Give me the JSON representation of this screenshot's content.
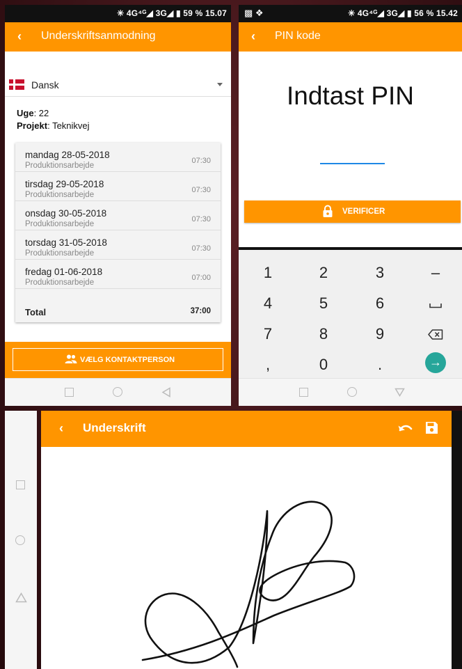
{
  "screen1": {
    "status": "✳ 4G⁴ᴳ◢ 3G◢ ▮ 59 % 15.07",
    "title": "Underskriftsanmodning",
    "language": "Dansk",
    "week_label": "Uge",
    "week_value": ": 22",
    "project_label": "Projekt",
    "project_value": ": Teknikvej",
    "days": [
      {
        "name": "mandag 28-05-2018",
        "type": "Produktionsarbejde",
        "hours": "07:30"
      },
      {
        "name": "tirsdag 29-05-2018",
        "type": "Produktionsarbejde",
        "hours": "07:30"
      },
      {
        "name": "onsdag 30-05-2018",
        "type": "Produktionsarbejde",
        "hours": "07:30"
      },
      {
        "name": "torsdag 31-05-2018",
        "type": "Produktionsarbejde",
        "hours": "07:30"
      },
      {
        "name": "fredag 01-06-2018",
        "type": "Produktionsarbejde",
        "hours": "07:00"
      }
    ],
    "total_label": "Total",
    "total_value": "37:00",
    "contact_button": "VÆLG KONTAKTPERSON"
  },
  "screen2": {
    "status": "✳ 4G⁴ᴳ◢ 3G◢ ▮ 56 % 15.42",
    "title": "PIN kode",
    "heading": "Indtast PIN",
    "verify_button": "VERIFICER",
    "keys": {
      "k1": "1",
      "k2": "2",
      "k3": "3",
      "dash": "–",
      "k4": "4",
      "k5": "5",
      "k6": "6",
      "k7": "7",
      "k8": "8",
      "k9": "9",
      "comma": ",",
      "k0": "0",
      "dot": "."
    }
  },
  "screen3": {
    "title": "Underskrift"
  },
  "colors": {
    "accent": "#ff9500",
    "pin_underline": "#1e88e5",
    "enter_key": "#26a69a"
  },
  "icons": [
    "back-icon",
    "dropdown-icon",
    "people-icon",
    "lock-icon",
    "space-icon",
    "backspace-icon",
    "enter-icon",
    "undo-icon",
    "save-icon"
  ]
}
